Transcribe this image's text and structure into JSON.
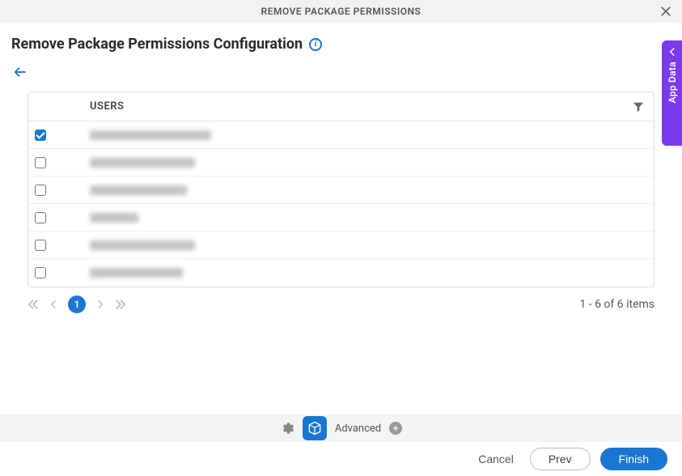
{
  "dialog": {
    "title": "REMOVE PACKAGE PERMISSIONS"
  },
  "page": {
    "title": "Remove Package Permissions Configuration"
  },
  "table": {
    "header": "USERS",
    "rows": [
      {
        "checked": true,
        "nameWidth": 150
      },
      {
        "checked": false,
        "nameWidth": 130
      },
      {
        "checked": false,
        "nameWidth": 120
      },
      {
        "checked": false,
        "nameWidth": 60
      },
      {
        "checked": false,
        "nameWidth": 130
      },
      {
        "checked": false,
        "nameWidth": 115
      }
    ]
  },
  "pager": {
    "page": "1",
    "summary": "1 - 6 of 6 items"
  },
  "footer": {
    "advanced": "Advanced"
  },
  "actions": {
    "cancel": "Cancel",
    "prev": "Prev",
    "finish": "Finish"
  },
  "sideTab": {
    "label": "App Data"
  }
}
